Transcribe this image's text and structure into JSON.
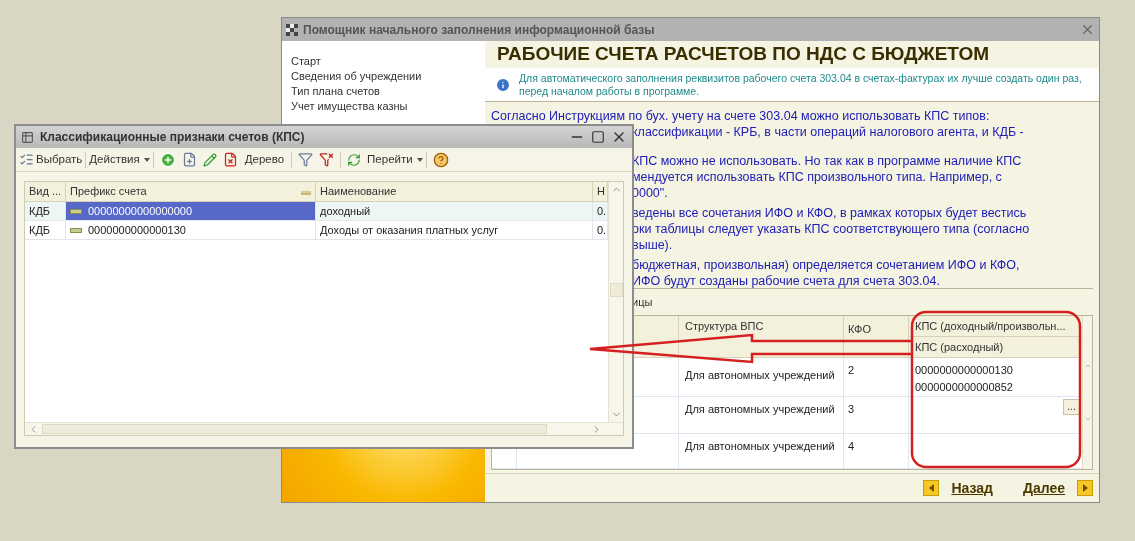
{
  "main_window": {
    "title": "Помощник начального заполнения информационной базы",
    "sidebar": {
      "items": [
        "Старт",
        "Сведения об учреждении",
        "Тип плана счетов",
        "Учет имущества казны"
      ]
    },
    "heading": "РАБОЧИЕ СЧЕТА РАСЧЕТОВ ПО НДС С БЮДЖЕТОМ",
    "info_note": "Для автоматического заполнения реквизитов рабочего счета 303.04 в счетах-фактурах их лучше создать один раз, перед началом работы в программе.",
    "paragraphs": [
      [
        "Согласно Инструкциям по бух. учету на счете 303.04 можно использовать КПС типов:",
        "классификации - КРБ, в части операций налогового агента, и КДБ -"
      ],
      [
        "КПС можно не использовать. Но так как в программе наличие КПС",
        "мендуется использовать КПС произвольного типа. Например, с",
        "0000\"."
      ],
      [
        "ведены все сочетания ИФО и КФО, в рамках которых будет вестись",
        "оки таблицы следует указать КПС соответствующего типа (согласно",
        "выше)."
      ],
      [
        "бюджетная, произвольная) определяется сочетанием ИФО и КФО,",
        "ИФО будут созданы рабочие счета для счета 303.04."
      ]
    ],
    "table_label": "ицы",
    "table": {
      "columns": [
        "Структура ВПС",
        "КФО",
        "КПС (доходный/произвольн..."
      ],
      "subheader": "КПС (расходный)",
      "rows": [
        {
          "structure": "Для автономных учреждений",
          "kfo": "2",
          "kps": [
            "0000000000000130",
            "0000000000000852"
          ],
          "picker": false
        },
        {
          "structure": "Для автономных учреждений",
          "kfo": "3",
          "kps": [],
          "picker": true
        },
        {
          "structure": "Для автономных учреждений",
          "kfo": "4",
          "kps": [],
          "picker": false
        }
      ],
      "picker_label": "..."
    },
    "nav": [
      {
        "label": "Назад",
        "kind": "back"
      },
      {
        "label": "Далее",
        "kind": "next"
      }
    ]
  },
  "kps_window": {
    "title": "Классификационные признаки счетов (КПС)",
    "toolbar": {
      "select": "Выбрать",
      "actions": "Действия",
      "tree": "Дерево",
      "goto": "Перейти"
    },
    "columns": [
      {
        "label": "Вид ...",
        "sorted": false
      },
      {
        "label": "Префикс счета",
        "sorted": true
      },
      {
        "label": "Наименование",
        "sorted": false
      },
      {
        "label": "Н",
        "sorted": false
      }
    ],
    "rows": [
      {
        "cells": [
          "КДБ",
          "00000000000000000",
          "доходный",
          "0."
        ],
        "selected": true
      },
      {
        "cells": [
          "КДБ",
          "0000000000000130",
          "Доходы от оказания платных услуг",
          "0."
        ],
        "selected": false
      }
    ]
  }
}
